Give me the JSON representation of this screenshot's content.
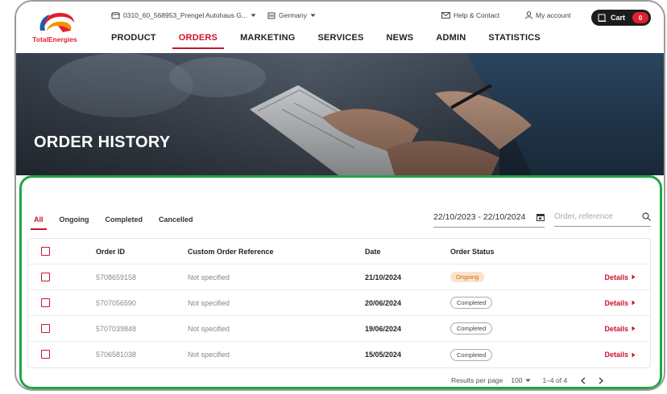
{
  "header": {
    "logo_text": "TotalEnergies",
    "account_selector": "0310_60_568953_Prengel Autohaus G...",
    "country": "Germany",
    "help_label": "Help & Contact",
    "account_label": "My account",
    "cart_label": "Cart",
    "cart_count": "0",
    "nav": [
      "PRODUCT",
      "ORDERS",
      "MARKETING",
      "SERVICES",
      "NEWS",
      "ADMIN",
      "STATISTICS"
    ],
    "active_nav": "ORDERS"
  },
  "hero": {
    "title": "ORDER HISTORY"
  },
  "filters": {
    "tabs": [
      "All",
      "Ongoing",
      "Completed",
      "Cancelled"
    ],
    "active_tab": "All",
    "date_range": "22/10/2023 - 22/10/2024",
    "search_placeholder": "Order, reference"
  },
  "table": {
    "headers": [
      "Order ID",
      "Custom Order Reference",
      "Date",
      "Order Status"
    ],
    "rows": [
      {
        "id": "5708659158",
        "ref": "Not specified",
        "date": "21/10/2024",
        "status": "Ongoing",
        "details": "Details"
      },
      {
        "id": "5707056590",
        "ref": "Not specified",
        "date": "20/06/2024",
        "status": "Completed",
        "details": "Details"
      },
      {
        "id": "5707039848",
        "ref": "Not specified",
        "date": "19/06/2024",
        "status": "Completed",
        "details": "Details"
      },
      {
        "id": "5706581038",
        "ref": "Not specified",
        "date": "15/05/2024",
        "status": "Completed",
        "details": "Details"
      }
    ]
  },
  "pagination": {
    "results_label": "Results per page",
    "per_page": "100",
    "range": "1–4 of 4"
  },
  "colors": {
    "brand_red": "#d0112b",
    "highlight_green": "#1fa647",
    "ongoing_bg": "#fbe3c9"
  }
}
